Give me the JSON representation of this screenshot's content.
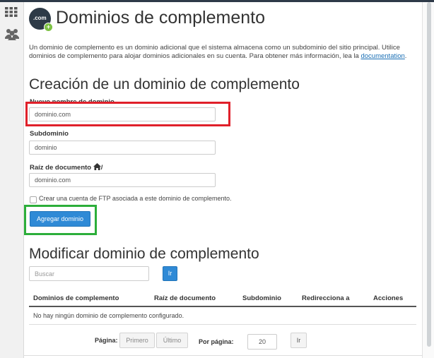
{
  "sidebar": {
    "items": [
      {
        "icon": "grid-icon"
      },
      {
        "icon": "users-icon"
      }
    ]
  },
  "header": {
    "logo_text": ".com",
    "title": "Dominios de complemento",
    "description": "Un dominio de complemento es un dominio adicional que el sistema almacena como un subdominio del sitio principal. Utilice dominios de complemento para alojar dominios adicionales en su cuenta. Para obtener más información, lea la ",
    "doc_link": "documentation",
    "doc_suffix": "."
  },
  "create": {
    "heading": "Creación de un dominio de complemento",
    "new_domain_label": "Nuevo nombre de dominio",
    "new_domain_value": "dominio.com",
    "subdomain_label": "Subdominio",
    "subdomain_value": "dominio",
    "docroot_label": "Raíz de documento",
    "docroot_suffix": "/",
    "docroot_value": "dominio.com",
    "ftp_checkbox_label": "Crear una cuenta de FTP asociada a este dominio de complemento.",
    "ftp_checked": false,
    "submit_label": "Agregar dominio"
  },
  "modify": {
    "heading": "Modificar dominio de complemento",
    "search_placeholder": "Buscar",
    "search_button": "Ir",
    "columns": [
      "Dominios de complemento",
      "Raíz de documento",
      "Subdominio",
      "Redirecciona a",
      "Acciones"
    ],
    "empty_message": "No hay ningún dominio de complemento configurado.",
    "pagination": {
      "page_label": "Página:",
      "first": "Primero",
      "last": "Último",
      "per_page_label": "Por página:",
      "per_page_value": "20",
      "go": "Ir"
    }
  },
  "colors": {
    "accent": "#2f8ad6",
    "highlight_red": "#e0202a",
    "highlight_green": "#2cae3a",
    "logo_bg": "#2d3a47"
  }
}
